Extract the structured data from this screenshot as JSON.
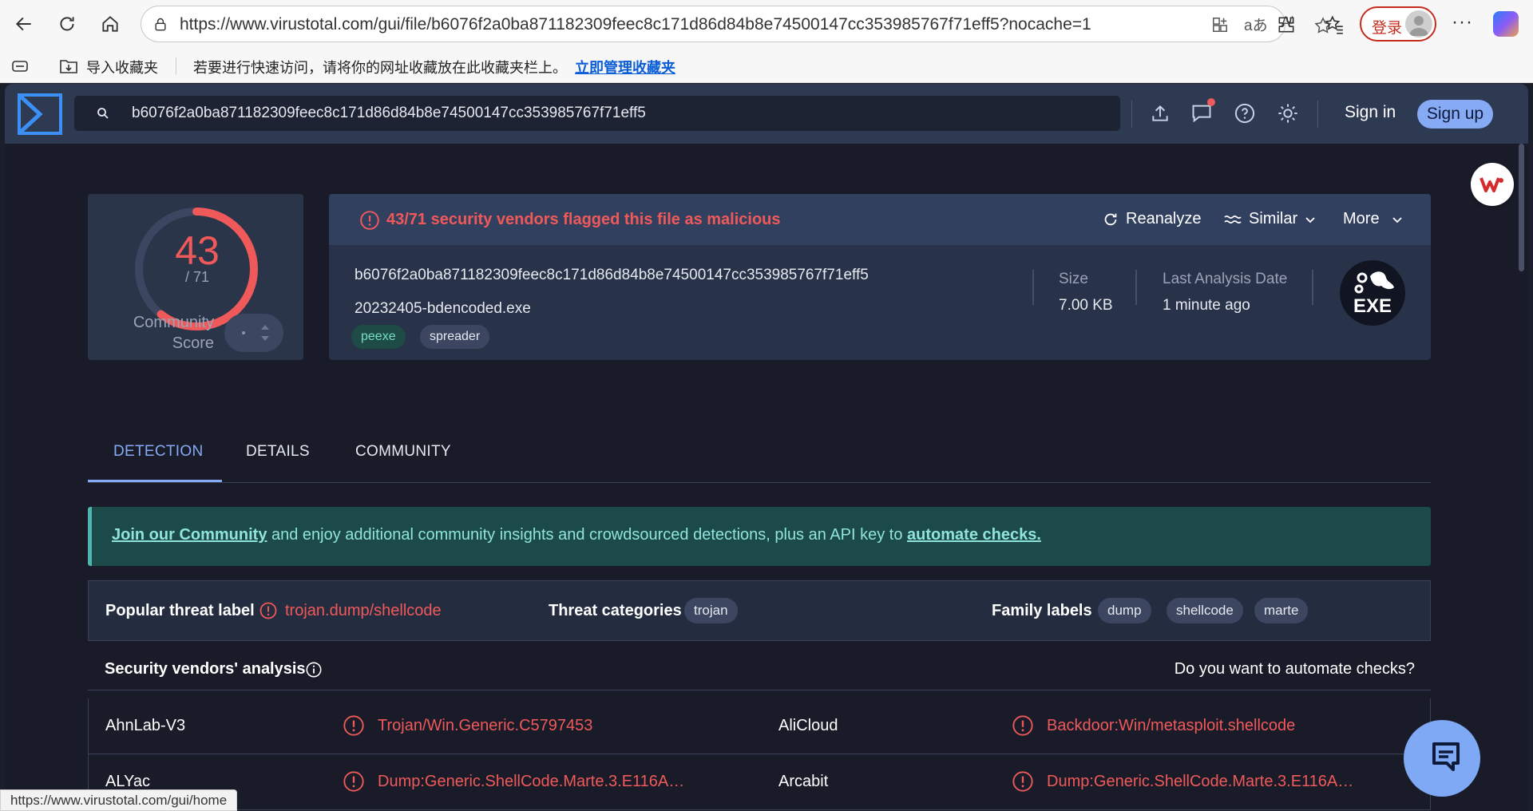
{
  "browser": {
    "url": "https://www.virustotal.com/gui/file/b6076f2a0ba871182309feec8c171d86d84b8e74500147cc353985767f71eff5?nocache=1",
    "login_label": "登录",
    "favorites": {
      "import_label": "导入收藏夹",
      "hint": "若要进行快速访问，请将你的网址收藏放在此收藏夹栏上。",
      "manage_link": "立即管理收藏夹"
    },
    "status_url": "https://www.virustotal.com/gui/home"
  },
  "header": {
    "search_value": "b6076f2a0ba871182309feec8c171d86d84b8e74500147cc353985767f71eff5",
    "signin_label": "Sign in",
    "signup_label": "Sign up"
  },
  "score": {
    "detections": "43",
    "total": "/ 71",
    "community_label_1": "Community",
    "community_label_2": "Score"
  },
  "summary": {
    "flag_message": "43/71 security vendors flagged this file as malicious",
    "actions": {
      "reanalyze": "Reanalyze",
      "similar": "Similar",
      "more": "More"
    },
    "hash": "b6076f2a0ba871182309feec8c171d86d84b8e74500147cc353985767f71eff5",
    "filename": "20232405-bdencoded.exe",
    "tags": [
      "peexe",
      "spreader"
    ],
    "size_label": "Size",
    "size_value": "7.00 KB",
    "date_label": "Last Analysis Date",
    "date_value": "1 minute ago",
    "file_type": "EXE"
  },
  "tabs": [
    "DETECTION",
    "DETAILS",
    "COMMUNITY"
  ],
  "banner": {
    "link1": "Join our Community",
    "middle": " and enjoy additional community insights and crowdsourced detections, plus an API key to ",
    "link2": "automate checks."
  },
  "threat": {
    "popular_label": "Popular threat label",
    "popular_value": "trojan.dump/shellcode",
    "categories_label": "Threat categories",
    "categories": [
      "trojan"
    ],
    "family_label": "Family labels",
    "families": [
      "dump",
      "shellcode",
      "marte"
    ]
  },
  "vendors": {
    "title": "Security vendors' analysis",
    "automate_prompt": "Do you want to automate checks?",
    "rows": [
      {
        "left_name": "AhnLab-V3",
        "left_result": "Trojan/Win.Generic.C5797453",
        "right_name": "AliCloud",
        "right_result": "Backdoor:Win/metasploit.shellcode"
      },
      {
        "left_name": "ALYac",
        "left_result": "Dump:Generic.ShellCode.Marte.3.E116A…",
        "right_name": "Arcabit",
        "right_result": "Dump:Generic.ShellCode.Marte.3.E116A…"
      }
    ]
  },
  "colors": {
    "malicious": "#f0595a",
    "accent": "#87aaf5",
    "header_bg": "#2e3952",
    "page_bg": "#191c28"
  }
}
